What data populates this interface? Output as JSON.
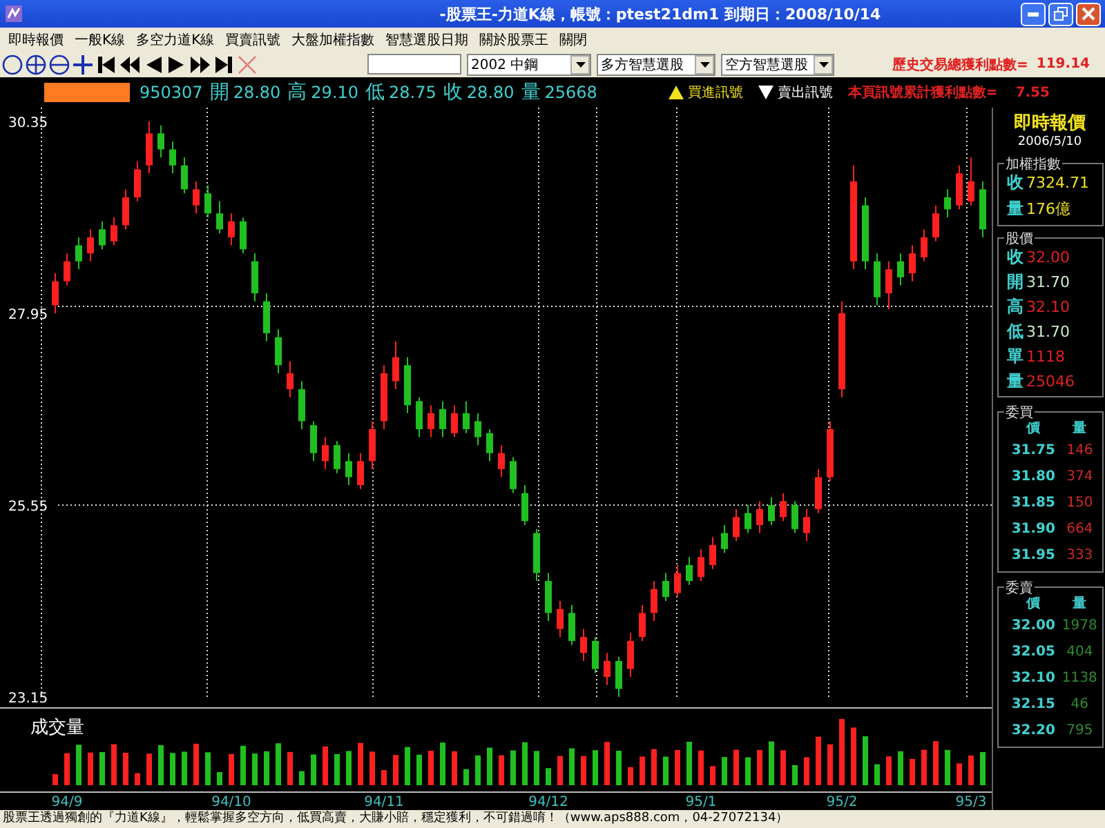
{
  "window": {
    "title": "-股票王-力道K線，帳號：ptest21dm1  到期日：2008/10/14"
  },
  "menu": [
    "即時報價",
    "一般K線",
    "多空力道K線",
    "買賣訊號",
    "大盤加權指數",
    "智慧選股日期",
    "關於股票王",
    "關閉"
  ],
  "toolbar": {
    "dropdowns": [
      {
        "value": "2002 中鋼"
      },
      {
        "value": "多方智慧選股"
      },
      {
        "value": "空方智慧選股"
      }
    ],
    "history_profit": {
      "label": "歷史交易總獲利點數=",
      "value": "119.14"
    }
  },
  "quote_bar": {
    "date": "950307",
    "items": [
      {
        "label": "開",
        "value": "28.80"
      },
      {
        "label": "高",
        "value": "29.10"
      },
      {
        "label": "低",
        "value": "28.75"
      },
      {
        "label": "收",
        "value": "28.80"
      },
      {
        "label": "量",
        "value": "25668"
      }
    ],
    "buy_legend": "買進訊號",
    "sell_legend": "賣出訊號",
    "page_profit": {
      "label": "本頁訊號累計獲利點數=",
      "value": "7.55"
    }
  },
  "chart": {
    "volume_label": "成交量",
    "chart_data": {
      "type": "candlestick",
      "ylim": [
        23.15,
        30.35
      ],
      "yticks": [
        30.35,
        27.95,
        25.55,
        23.15
      ],
      "categories": [
        null,
        "94/9",
        null,
        null,
        null,
        null,
        null,
        null,
        null,
        null,
        null,
        null,
        null,
        null,
        null,
        "94/10",
        null,
        null,
        null,
        null,
        null,
        null,
        null,
        null,
        null,
        null,
        null,
        null,
        "94/11",
        null,
        null,
        null,
        null,
        null,
        null,
        null,
        null,
        null,
        null,
        null,
        null,
        null,
        "94/12",
        null,
        null,
        null,
        null,
        null,
        null,
        null,
        null,
        null,
        null,
        null,
        null,
        "95/1",
        null,
        null,
        null,
        null,
        null,
        null,
        null,
        null,
        null,
        null,
        null,
        "95/2",
        null,
        null,
        null,
        null,
        null,
        null,
        null,
        null,
        null,
        null,
        "95/3",
        null
      ],
      "ohlc": [
        [
          28.05,
          28.45,
          27.95,
          28.35
        ],
        [
          28.35,
          28.7,
          28.3,
          28.6
        ],
        [
          28.8,
          28.9,
          28.5,
          28.6
        ],
        [
          28.7,
          29.0,
          28.6,
          28.9
        ],
        [
          29.0,
          29.1,
          28.75,
          28.8
        ],
        [
          28.85,
          29.15,
          28.8,
          29.05
        ],
        [
          29.05,
          29.5,
          29.0,
          29.4
        ],
        [
          29.4,
          29.85,
          29.35,
          29.75
        ],
        [
          29.8,
          30.35,
          29.7,
          30.2
        ],
        [
          30.2,
          30.3,
          29.9,
          30.0
        ],
        [
          30.0,
          30.1,
          29.7,
          29.8
        ],
        [
          29.8,
          29.9,
          29.45,
          29.5
        ],
        [
          29.3,
          29.6,
          29.2,
          29.5
        ],
        [
          29.45,
          29.55,
          29.15,
          29.2
        ],
        [
          29.2,
          29.35,
          28.95,
          29.0
        ],
        [
          28.9,
          29.2,
          28.8,
          29.1
        ],
        [
          29.1,
          29.15,
          28.7,
          28.75
        ],
        [
          28.6,
          28.7,
          28.1,
          28.2
        ],
        [
          28.1,
          28.2,
          27.6,
          27.7
        ],
        [
          27.65,
          27.75,
          27.2,
          27.3
        ],
        [
          27.0,
          27.35,
          26.9,
          27.2
        ],
        [
          27.0,
          27.1,
          26.5,
          26.6
        ],
        [
          26.55,
          26.6,
          26.1,
          26.2
        ],
        [
          26.1,
          26.4,
          26.0,
          26.3
        ],
        [
          26.3,
          26.35,
          25.95,
          26.0
        ],
        [
          26.1,
          26.2,
          25.8,
          25.9
        ],
        [
          25.8,
          26.2,
          25.75,
          26.1
        ],
        [
          26.1,
          26.6,
          26.0,
          26.5
        ],
        [
          26.6,
          27.3,
          26.5,
          27.2
        ],
        [
          27.1,
          27.6,
          27.0,
          27.4
        ],
        [
          27.3,
          27.4,
          26.7,
          26.8
        ],
        [
          26.85,
          26.9,
          26.4,
          26.5
        ],
        [
          26.5,
          26.8,
          26.4,
          26.7
        ],
        [
          26.75,
          26.85,
          26.4,
          26.5
        ],
        [
          26.45,
          26.8,
          26.4,
          26.7
        ],
        [
          26.7,
          26.85,
          26.45,
          26.5
        ],
        [
          26.6,
          26.7,
          26.3,
          26.4
        ],
        [
          26.45,
          26.5,
          26.1,
          26.2
        ],
        [
          26.0,
          26.3,
          25.9,
          26.2
        ],
        [
          26.1,
          26.15,
          25.7,
          25.75
        ],
        [
          25.7,
          25.8,
          25.3,
          25.35
        ],
        [
          25.2,
          25.25,
          24.6,
          24.7
        ],
        [
          24.6,
          24.7,
          24.1,
          24.2
        ],
        [
          24.0,
          24.35,
          23.9,
          24.25
        ],
        [
          24.2,
          24.3,
          23.8,
          23.85
        ],
        [
          23.7,
          24.0,
          23.6,
          23.9
        ],
        [
          23.85,
          23.9,
          23.45,
          23.5
        ],
        [
          23.4,
          23.7,
          23.3,
          23.6
        ],
        [
          23.6,
          23.65,
          23.15,
          23.25
        ],
        [
          23.5,
          23.95,
          23.4,
          23.85
        ],
        [
          23.9,
          24.3,
          23.85,
          24.2
        ],
        [
          24.2,
          24.6,
          24.1,
          24.5
        ],
        [
          24.6,
          24.7,
          24.35,
          24.4
        ],
        [
          24.45,
          24.8,
          24.4,
          24.7
        ],
        [
          24.8,
          24.9,
          24.55,
          24.6
        ],
        [
          24.65,
          25.0,
          24.6,
          24.9
        ],
        [
          24.8,
          25.15,
          24.75,
          25.05
        ],
        [
          25.2,
          25.3,
          24.95,
          25.0
        ],
        [
          25.15,
          25.5,
          25.1,
          25.4
        ],
        [
          25.45,
          25.55,
          25.2,
          25.25
        ],
        [
          25.3,
          25.6,
          25.2,
          25.5
        ],
        [
          25.55,
          25.65,
          25.3,
          25.35
        ],
        [
          25.4,
          25.7,
          25.35,
          25.6
        ],
        [
          25.55,
          25.6,
          25.2,
          25.25
        ],
        [
          25.2,
          25.5,
          25.1,
          25.4
        ],
        [
          25.5,
          26.0,
          25.45,
          25.9
        ],
        [
          25.9,
          26.6,
          25.85,
          26.5
        ],
        [
          27.0,
          28.1,
          26.9,
          27.95
        ],
        [
          28.6,
          29.8,
          28.5,
          29.6
        ],
        [
          29.3,
          29.4,
          28.5,
          28.6
        ],
        [
          28.6,
          28.7,
          28.05,
          28.15
        ],
        [
          28.2,
          28.6,
          28.0,
          28.5
        ],
        [
          28.6,
          28.7,
          28.3,
          28.4
        ],
        [
          28.45,
          28.8,
          28.35,
          28.7
        ],
        [
          28.65,
          29.0,
          28.6,
          28.9
        ],
        [
          28.9,
          29.3,
          28.85,
          29.2
        ],
        [
          29.4,
          29.5,
          29.15,
          29.25
        ],
        [
          29.3,
          29.8,
          29.25,
          29.7
        ],
        [
          29.35,
          29.9,
          29.3,
          29.6
        ],
        [
          29.5,
          29.6,
          28.9,
          29.0
        ]
      ]
    }
  },
  "panel": {
    "title": "即時報價",
    "date": "2006/5/10",
    "index": {
      "title": "加權指數",
      "rows": [
        {
          "label": "收",
          "value": "7324.71"
        },
        {
          "label": "量",
          "value": "176億"
        }
      ]
    },
    "stock": {
      "title": "股價",
      "rows": [
        {
          "label": "收",
          "value": "32.00",
          "color": "#e02020"
        },
        {
          "label": "開",
          "value": "31.70",
          "color": "#c8ecc8"
        },
        {
          "label": "高",
          "value": "32.10",
          "color": "#e02020"
        },
        {
          "label": "低",
          "value": "31.70",
          "color": "#c8ecc8"
        },
        {
          "label": "單",
          "value": "1118",
          "color": "#e02020"
        },
        {
          "label": "量",
          "value": "25046",
          "color": "#e02020"
        }
      ]
    },
    "books": [
      {
        "title": "委買",
        "headers": [
          "價",
          "量"
        ],
        "color": "#d02828",
        "rows": [
          {
            "price": "31.75",
            "volume": "146"
          },
          {
            "price": "31.80",
            "volume": "374"
          },
          {
            "price": "31.85",
            "volume": "150"
          },
          {
            "price": "31.90",
            "volume": "664"
          },
          {
            "price": "31.95",
            "volume": "333"
          }
        ]
      },
      {
        "title": "委賣",
        "headers": [
          "價",
          "量"
        ],
        "color": "#2e8b2e",
        "rows": [
          {
            "price": "32.00",
            "volume": "1978"
          },
          {
            "price": "32.05",
            "volume": "404"
          },
          {
            "price": "32.10",
            "volume": "1138"
          },
          {
            "price": "32.15",
            "volume": "46"
          },
          {
            "price": "32.20",
            "volume": "795"
          }
        ]
      }
    ]
  },
  "status_bar": "股票王透過獨創的『力道K線』，輕鬆掌握多空方向，低買高賣，大賺小賠，穩定獲利，不可錯過唷！（www.aps888.com，04-27072134）"
}
